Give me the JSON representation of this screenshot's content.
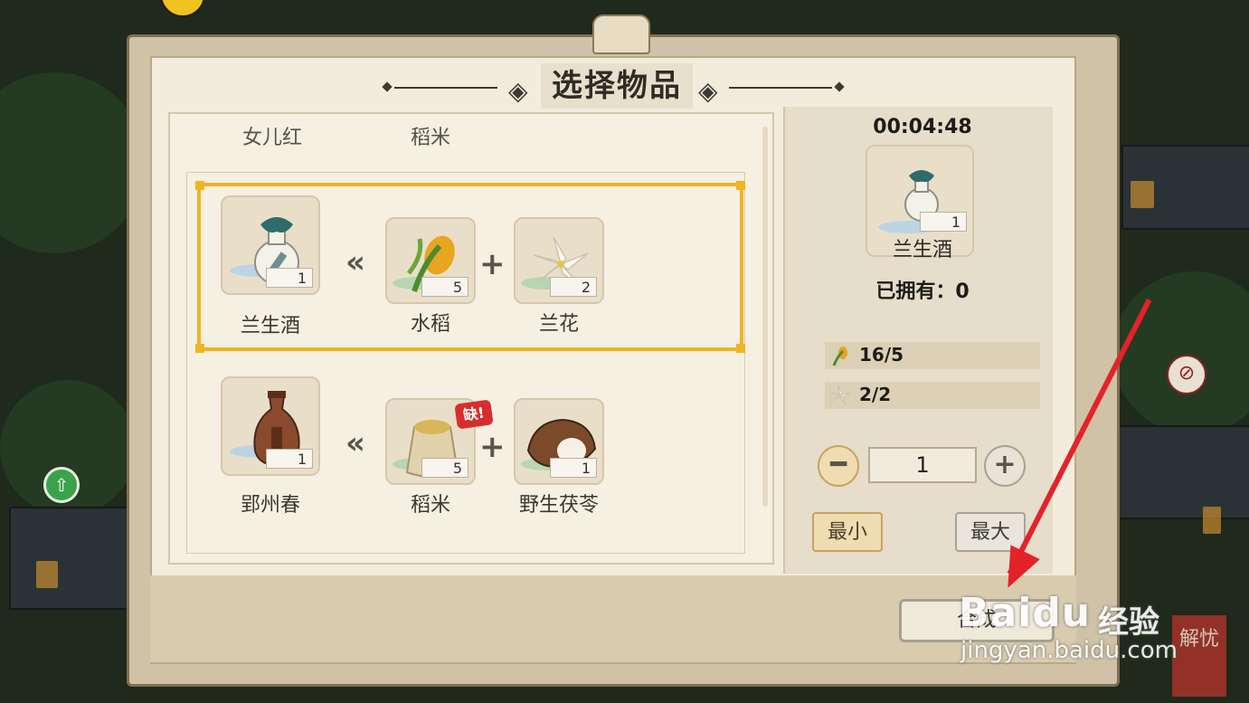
{
  "dialog": {
    "title": "选择物品",
    "title_left_ornament": "◈",
    "title_right_ornament": "◈"
  },
  "list": {
    "partial_row_labels": [
      "女儿红",
      "稻米"
    ],
    "recipes": [
      {
        "selected": true,
        "result": {
          "name": "兰生酒",
          "count": "1",
          "icon": "green-wine-bottle-icon"
        },
        "arrow": "«",
        "ingredients": [
          {
            "name": "水稻",
            "count": "5",
            "icon": "rice-plant-icon",
            "missing": false
          },
          {
            "name": "兰花",
            "count": "2",
            "icon": "orchid-flower-icon",
            "missing": false
          }
        ],
        "plus": "+"
      },
      {
        "selected": false,
        "result": {
          "name": "郢州春",
          "count": "1",
          "icon": "brown-wine-jar-icon"
        },
        "arrow": "«",
        "ingredients": [
          {
            "name": "稻米",
            "count": "5",
            "icon": "rice-sack-icon",
            "missing": true,
            "missing_label": "缺!"
          },
          {
            "name": "野生茯苓",
            "count": "1",
            "icon": "poria-mushroom-icon",
            "missing": false
          }
        ],
        "plus": "+"
      }
    ]
  },
  "detail": {
    "timer": "00:04:48",
    "item_name": "兰生酒",
    "item_count": "1",
    "owned_text": "已拥有：0",
    "requirements": [
      {
        "icon": "rice-plant-icon",
        "text": "16/5"
      },
      {
        "icon": "orchid-flower-icon",
        "text": "2/2"
      }
    ],
    "quantity": "1",
    "minus_label": "━",
    "plus_label": "+",
    "min_label": "最小",
    "max_label": "最大"
  },
  "actions": {
    "confirm_label": "合成"
  },
  "watermark": {
    "brand": "Baidu",
    "cn": "经验",
    "url": "jingyan.baidu.com"
  },
  "scene": {
    "right_banner_text": "解忧",
    "side_icon": "⊘"
  },
  "colors": {
    "selected_border": "#f0b323",
    "missing_badge": "#d62e2e",
    "arrow_annotation": "#e4222a"
  }
}
